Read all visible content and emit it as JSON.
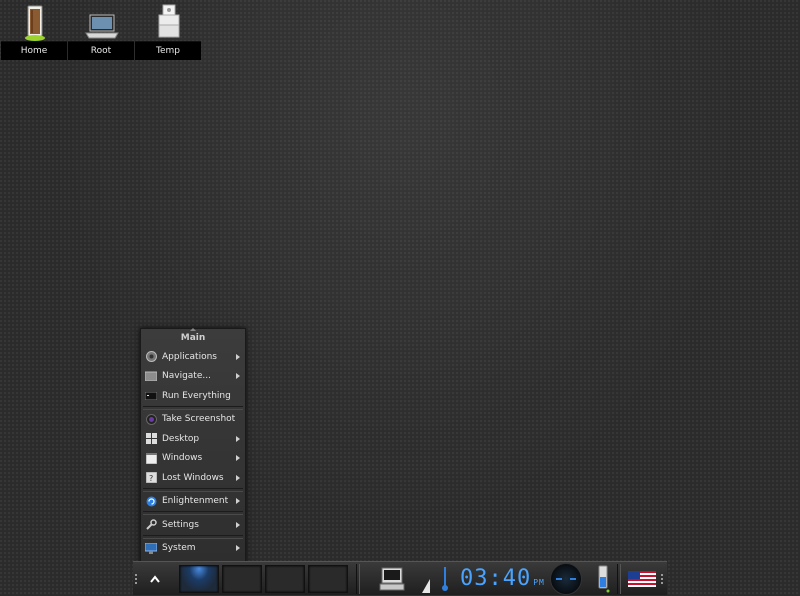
{
  "desktop_icons": [
    {
      "label": "Home",
      "icon": "home-door-icon"
    },
    {
      "label": "Root",
      "icon": "root-laptop-icon"
    },
    {
      "label": "Temp",
      "icon": "temp-stack-icon"
    }
  ],
  "menu": {
    "title": "Main",
    "items": [
      {
        "label": "Applications",
        "icon": "applications-gear-icon",
        "submenu": true
      },
      {
        "label": "Navigate...",
        "icon": "folder-icon",
        "submenu": true
      },
      {
        "label": "Run Everything",
        "icon": "terminal-icon",
        "submenu": false
      },
      {
        "label": "Take Screenshot",
        "icon": "camera-lens-icon",
        "submenu": false
      },
      {
        "label": "Desktop",
        "icon": "desktop-grid-icon",
        "submenu": true
      },
      {
        "label": "Windows",
        "icon": "window-icon",
        "submenu": true
      },
      {
        "label": "Lost Windows",
        "icon": "lost-window-icon",
        "submenu": true
      },
      {
        "label": "Enlightenment",
        "icon": "enlightenment-logo-icon",
        "submenu": true
      },
      {
        "label": "Settings",
        "icon": "wrench-icon",
        "submenu": true
      },
      {
        "label": "System",
        "icon": "system-computer-icon",
        "submenu": true
      }
    ]
  },
  "shelf": {
    "clock_time": "03:40",
    "clock_ampm": "PM",
    "active_desktop": 1,
    "desktops": 4,
    "colors": {
      "clock": "#4aa4ff",
      "accent": "#2f7fe0"
    }
  }
}
